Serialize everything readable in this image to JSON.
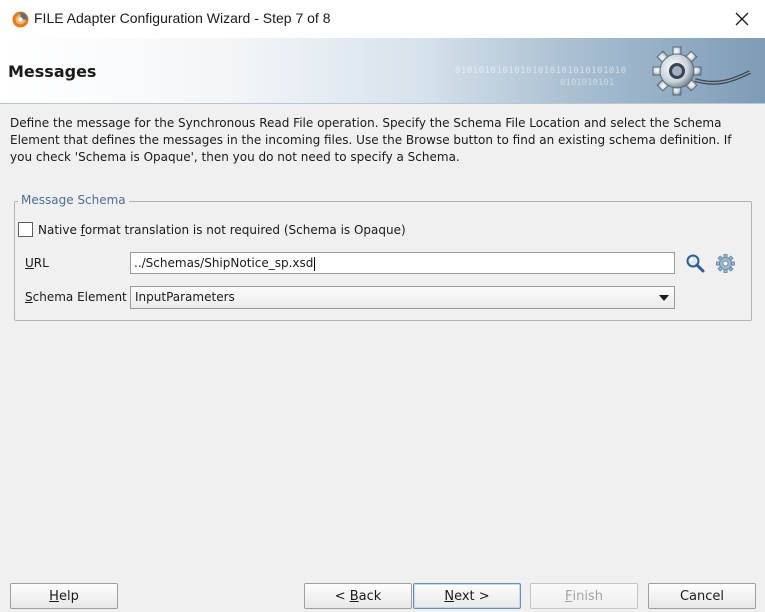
{
  "window": {
    "title": "FILE Adapter Configuration Wizard - Step 7 of 8"
  },
  "header": {
    "title": "Messages",
    "decoration_binary_1": "01010101010101010101010101010",
    "decoration_binary_2": "0101010101"
  },
  "description": "Define the message for the Synchronous Read File operation.  Specify the Schema File Location and select the Schema Element that defines the messages in the incoming files. Use the Browse button to find an existing schema definition. If you check 'Schema is Opaque', then you do not need to specify a Schema.",
  "message_schema": {
    "legend": "Message Schema",
    "opaque_checkbox": {
      "label_pre": "Native ",
      "label_mnemonic": "f",
      "label_post": "ormat translation is not required (Schema is Opaque)",
      "checked": false
    },
    "url": {
      "label_mnemonic": "U",
      "label_post": "RL",
      "value": "../Schemas/ShipNotice_sp.xsd"
    },
    "schema_element": {
      "label_mnemonic": "S",
      "label_post": "chema Element",
      "selected": "InputParameters"
    },
    "icons": {
      "browse": "search-icon",
      "settings": "gear-icon"
    }
  },
  "buttons": {
    "help": {
      "mnemonic": "H",
      "rest": "elp"
    },
    "back": {
      "prefix": "< ",
      "mnemonic": "B",
      "rest": "ack"
    },
    "next": {
      "mnemonic": "N",
      "rest": "ext >"
    },
    "finish": {
      "mnemonic": "F",
      "rest": "inish",
      "disabled": true
    },
    "cancel": {
      "label": "Cancel"
    }
  }
}
